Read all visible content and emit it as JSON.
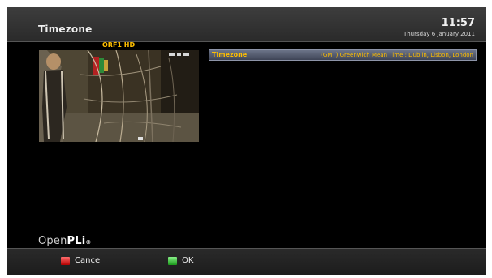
{
  "header": {
    "title": "Timezone",
    "time": "11:57",
    "date": "Thursday  6 January 2011"
  },
  "preview": {
    "channel_name": "ORF1 HD"
  },
  "settings": {
    "items": [
      {
        "label": "Timezone",
        "value": "(GMT) Greenwich Mean Time : Dublin, Lisbon, London"
      }
    ]
  },
  "branding": {
    "logo_light": "Open",
    "logo_bold": "PLi",
    "logo_tail": "®"
  },
  "footer": {
    "buttons": [
      {
        "label": "Cancel",
        "color": "#d22020",
        "icon": "red-key-icon"
      },
      {
        "label": "OK",
        "color": "#2aa52a",
        "icon": "green-key-icon"
      }
    ]
  }
}
